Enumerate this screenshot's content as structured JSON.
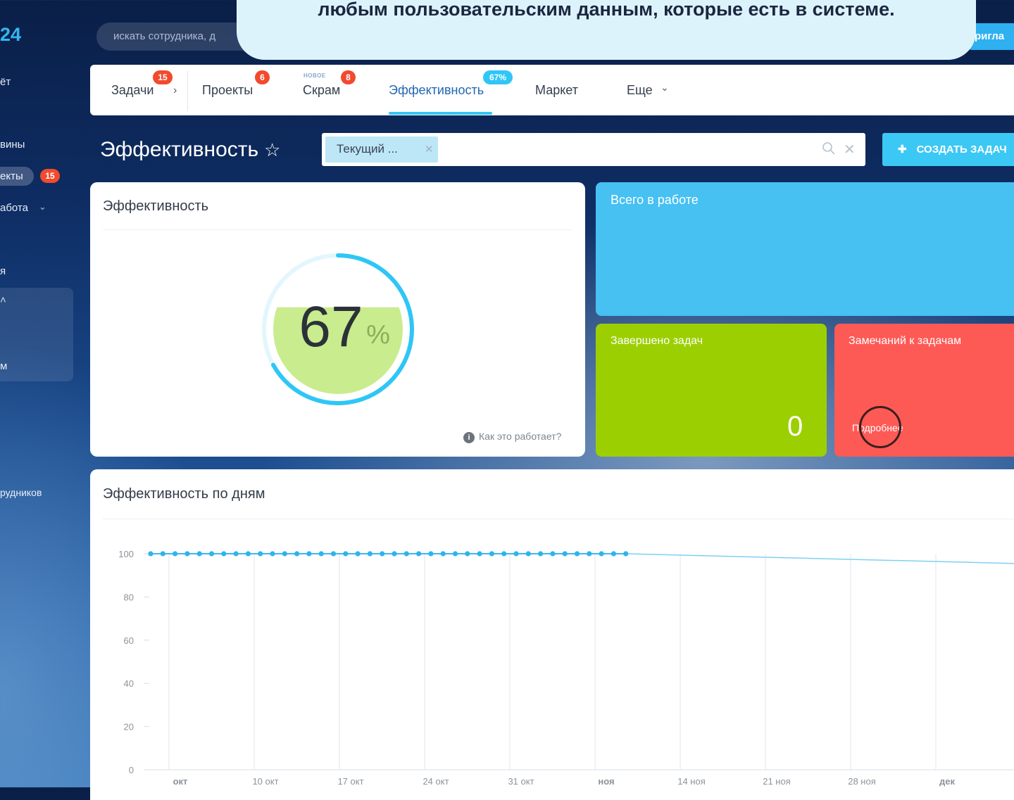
{
  "app": {
    "logo": "24"
  },
  "sidebar": {
    "items": [
      {
        "label": "ёт"
      },
      {
        "label": "вины"
      },
      {
        "label": "екты",
        "badge": "15"
      },
      {
        "label": "абота"
      },
      {
        "label": "я"
      },
      {
        "label": "м"
      },
      {
        "label": "рудников"
      }
    ]
  },
  "header": {
    "search_placeholder": "искать сотрудника, д",
    "invite_label": "ригла"
  },
  "callout": {
    "text": "любым пользовательским данным, которые есть в системе."
  },
  "tabs": [
    {
      "label": "Задачи",
      "badge": "15"
    },
    {
      "label": "Проекты",
      "badge": "6"
    },
    {
      "label": "Скрам",
      "badge": "8",
      "tag": "НОВОЕ"
    },
    {
      "label": "Эффективность",
      "badge": "67%",
      "active": true
    },
    {
      "label": "Маркет"
    },
    {
      "label": "Еще"
    }
  ],
  "page": {
    "title": "Эффективность",
    "filter_chip": "Текущий ...",
    "create_button": "СОЗДАТЬ ЗАДАЧ"
  },
  "efficiency_card": {
    "title": "Эффективность",
    "value": "67",
    "unit": "%",
    "fraction": 0.67,
    "help_link": "Как это работает?"
  },
  "stats": {
    "in_work": {
      "title": "Всего в работе"
    },
    "completed": {
      "title": "Завершено задач",
      "value": "0"
    },
    "remarks": {
      "title": "Замечаний к задачам",
      "link": "Подробнее"
    }
  },
  "colors": {
    "accent": "#2fc6f6",
    "badge": "#f24a2e",
    "tile_blue": "#47c0f2",
    "tile_green": "#9bcf02",
    "tile_red": "#fd5a56",
    "gauge_fill": "#c9ec8e"
  },
  "chart_data": {
    "type": "line",
    "title": "Эффективность по дням",
    "xlabel": "",
    "ylabel": "",
    "ylim": [
      0,
      100
    ],
    "yticks": [
      0,
      20,
      40,
      60,
      80,
      100
    ],
    "grid": true,
    "x_ticks": [
      {
        "label": "окт",
        "bold": true
      },
      {
        "label": "10 окт"
      },
      {
        "label": "17 окт"
      },
      {
        "label": "24 окт"
      },
      {
        "label": "31 окт"
      },
      {
        "label": "ноя",
        "bold": true
      },
      {
        "label": "14 ноя"
      },
      {
        "label": "21 ноя"
      },
      {
        "label": "28 ноя"
      },
      {
        "label": "дек",
        "bold": true
      }
    ],
    "series": [
      {
        "daily_points": [
          100,
          100,
          100,
          100,
          100,
          100,
          100,
          100,
          100,
          100,
          100,
          100,
          100,
          100,
          100,
          100,
          100,
          100,
          100,
          100,
          100,
          100,
          100,
          100,
          100,
          100,
          100,
          100,
          100,
          100,
          100,
          100,
          100,
          100,
          100,
          100,
          100,
          100,
          100,
          100
        ],
        "trend_end": 95.5
      }
    ]
  }
}
